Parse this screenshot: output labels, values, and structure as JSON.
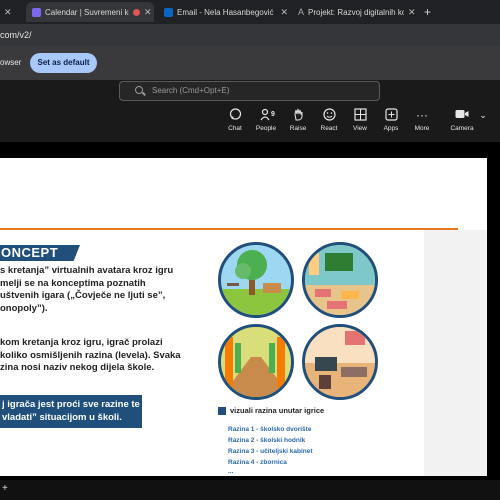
{
  "tabs": [
    {
      "label": "Calendar | Suvremeni kon"
    },
    {
      "label": "Email - Nela Hasanbegović -"
    },
    {
      "label": "Projekt: Razvoj digitalnih kor"
    }
  ],
  "new_tab_label": "+",
  "url": "com/v2/",
  "infobar": {
    "text": "owser",
    "button": "Set as default"
  },
  "search": {
    "placeholder": "Search (Cmd+Opt+E)"
  },
  "toolbar": {
    "chat": "Chat",
    "people": "People",
    "people_count": "9",
    "raise": "Raise",
    "react": "React",
    "view": "View",
    "apps": "Apps",
    "more": "More",
    "camera": "Camera"
  },
  "slide": {
    "heading": "ONCEPT",
    "para1": [
      "s kretanja” virtualnih avatara kroz igru",
      "melji se na konceptima poznatih",
      "uštvenih igara („Čovječe ne ljuti se”,",
      "onopoly”)."
    ],
    "para2": [
      "kom kretanja kroz igru, igrač prolazi",
      "koliko osmišljenih razina (levela). Svaka",
      "zina nosi naziv nekog dijela škole."
    ],
    "highlight": [
      "j igrača jest proći sve razine te",
      "vladati” situacijom u školi."
    ],
    "legend": "vizuali razina unutar igrice",
    "levels": [
      "Razina 1 - školsko dvorište",
      "Razina 2 - školski hodnik",
      "Razina 3 - učiteljski kabinet",
      "Razina 4 - zbornica",
      "..."
    ]
  },
  "bottom": "+",
  "colors": {
    "accent_blue": "#1f4f7a",
    "accent_orange": "#e87722",
    "button_blue": "#a8c7fa"
  }
}
